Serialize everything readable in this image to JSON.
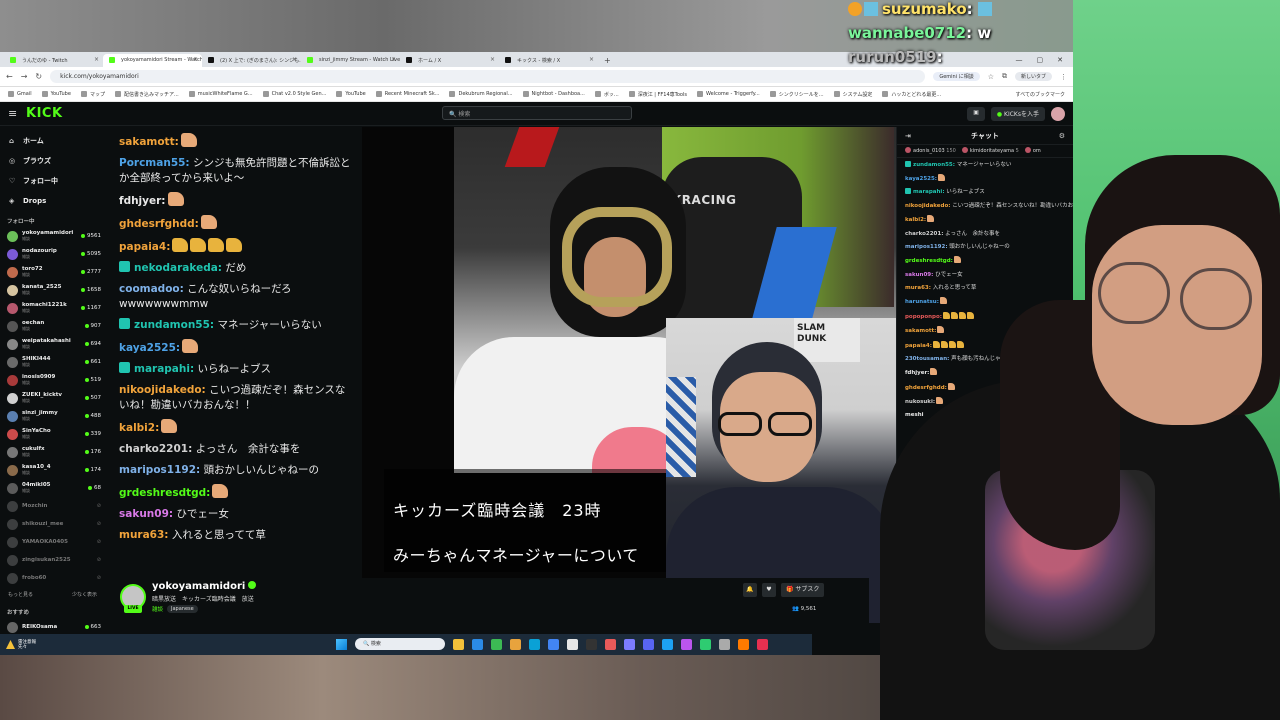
{
  "overlay_chat": [
    {
      "name": "suzumako",
      "text": ""
    },
    {
      "name": "wannabe0712",
      "text": "w"
    },
    {
      "name": "rurun0519",
      "text": ""
    }
  ],
  "browser": {
    "tabs": [
      {
        "label": "うんだのゆ - Twitch",
        "active": false
      },
      {
        "label": "yokoyamamidori Stream - Watch Live on KICK",
        "active": true
      },
      {
        "label": "(2) X 上で: (ぎのまさん): シンジも...",
        "active": false
      },
      {
        "label": "sinzi_jimmy Stream - Watch Live",
        "active": false
      },
      {
        "label": "ホーム / X",
        "active": false
      },
      {
        "label": "キックス - 検索 / X",
        "active": false
      }
    ],
    "new_tab": "+",
    "url": "kick.com/yokoyamamidori",
    "gemini": "Gemini に相談",
    "profile": "新しいタブ",
    "bookmarks": [
      "Gmail",
      "YouTube",
      "マップ",
      "配信書き込みマッチア...",
      "musicWhiteFlame G...",
      "Chat v2.0 Style Gen...",
      "YouTube",
      "Recent Minecraft Sk...",
      "Dekubrum Regional...",
      "Nightbot - Dashboa...",
      "ボッ...",
      "深夜江 | FF14専Tools",
      "Welcome - Triggerfy...",
      "シンクリシールを...",
      "システム設定",
      "ハッカとどれる最更..."
    ],
    "all_bookmarks": "すべてのブックマーク"
  },
  "kick": {
    "logo": "KICK",
    "search_placeholder": "検索",
    "join_label": "KICKsを入手",
    "nav": [
      {
        "label": "ホーム",
        "icon": "home-icon",
        "glyph": "⌂"
      },
      {
        "label": "ブラウズ",
        "icon": "browse-icon",
        "glyph": "◎"
      },
      {
        "label": "フォロー中",
        "icon": "following-icon",
        "glyph": "♡"
      },
      {
        "label": "Drops",
        "icon": "drops-icon",
        "glyph": "◈"
      }
    ],
    "following_label": "フォロー中",
    "following": [
      {
        "name": "yokoyamamidori",
        "sub": "雑談",
        "count": "9561",
        "online": true,
        "color": "#6bbf59"
      },
      {
        "name": "nodazourip",
        "sub": "雑談",
        "count": "5095",
        "online": true,
        "color": "#7b5ad6"
      },
      {
        "name": "toro72",
        "sub": "雑談",
        "count": "2777",
        "online": true,
        "color": "#c06a4c"
      },
      {
        "name": "kanata_2525",
        "sub": "雑談",
        "count": "1658",
        "online": true,
        "color": "#d6c4a0"
      },
      {
        "name": "komachi1221k",
        "sub": "雑談",
        "count": "1167",
        "online": true,
        "color": "#b6586d"
      },
      {
        "name": "oechan",
        "sub": "雑談",
        "count": "907",
        "online": true,
        "color": "#555"
      },
      {
        "name": "weipatakahashi",
        "sub": "雑談",
        "count": "694",
        "online": true,
        "color": "#888"
      },
      {
        "name": "SHIKI444",
        "sub": "雑談",
        "count": "661",
        "online": true,
        "color": "#6a6a6a"
      },
      {
        "name": "inosis0909",
        "sub": "雑談",
        "count": "519",
        "online": true,
        "color": "#a83a3a"
      },
      {
        "name": "ZUEKI_kicktv",
        "sub": "雑談",
        "count": "507",
        "online": true,
        "color": "#d0d0d0"
      },
      {
        "name": "sinzi_jimmy",
        "sub": "雑談",
        "count": "488",
        "online": true,
        "color": "#5a7fb0"
      },
      {
        "name": "SinYaCho",
        "sub": "雑談",
        "count": "339",
        "online": true,
        "color": "#cc4b4b"
      },
      {
        "name": "cukulfx",
        "sub": "雑談",
        "count": "176",
        "online": true,
        "color": "#777"
      },
      {
        "name": "kasa10_4",
        "sub": "雑談",
        "count": "174",
        "online": true,
        "color": "#8a6a4a"
      },
      {
        "name": "04mikl05",
        "sub": "雑談",
        "count": "68",
        "online": true,
        "color": "#5b5b5b"
      },
      {
        "name": "Mozchin",
        "sub": "",
        "count": "",
        "online": false,
        "color": "#888"
      },
      {
        "name": "shikouzi_mee",
        "sub": "",
        "count": "",
        "online": false,
        "color": "#888"
      },
      {
        "name": "YAMAOKA0405",
        "sub": "",
        "count": "",
        "online": false,
        "color": "#888"
      },
      {
        "name": "zingisukan2525",
        "sub": "",
        "count": "",
        "online": false,
        "color": "#888"
      },
      {
        "name": "frobo60",
        "sub": "",
        "count": "",
        "online": false,
        "color": "#888"
      }
    ],
    "show_more": "もっと見る",
    "show_less": "少なく表示",
    "recommended_label": "おすすめ",
    "recommended": [
      {
        "name": "REIKOsama",
        "count": "663"
      }
    ]
  },
  "big_chat": [
    {
      "user": "sakamott:",
      "color": "#f1a33b",
      "text": "",
      "emotes": 1,
      "badge": false
    },
    {
      "user": "Porcman55:",
      "color": "#4ea2e6",
      "text": "シンジも無免許問題と不倫訴訟とか全部終ってから来いよ〜",
      "emotes": 0,
      "badge": false
    },
    {
      "user": "fdhjyer:",
      "color": "#e8e8e8",
      "text": "",
      "emotes": 1,
      "badge": false
    },
    {
      "user": "ghdesrfghdd:",
      "color": "#f1a33b",
      "text": "",
      "emotes": 1,
      "badge": false
    },
    {
      "user": "papaia4:",
      "color": "#f1a33b",
      "text": "",
      "emotes": 4,
      "emote_style": "y",
      "badge": false
    },
    {
      "user": "nekodarakeda:",
      "color": "#20c4b0",
      "text": "だめ",
      "emotes": 0,
      "badge": true
    },
    {
      "user": "coomadoo:",
      "color": "#7fb1e8",
      "text": "こんな奴いらねーだろ wwwwwwwmmw",
      "emotes": 0,
      "badge": false
    },
    {
      "user": "zundamon55:",
      "color": "#20c4b0",
      "text": "マネージャーいらない",
      "emotes": 0,
      "badge": true
    },
    {
      "user": "kaya2525:",
      "color": "#4ea2e6",
      "text": "",
      "emotes": 1,
      "badge": false
    },
    {
      "user": "marapahi:",
      "color": "#20c4b0",
      "text": "いらねーよブス",
      "emotes": 0,
      "badge": true
    },
    {
      "user": "nikoojidakedo:",
      "color": "#f1a33b",
      "text": "こいつ過疎だぞ！森センスないね！勘違いバカおんな！！",
      "emotes": 0,
      "badge": false
    },
    {
      "user": "kalbi2:",
      "color": "#f1a33b",
      "text": "",
      "emotes": 1,
      "badge": false
    },
    {
      "user": "charko2201:",
      "color": "#d0d0d0",
      "text": "よっさん　余計な事を",
      "emotes": 0,
      "badge": false
    },
    {
      "user": "maripos1192:",
      "color": "#7fb1e8",
      "text": "頭おかしいんじゃねーの",
      "emotes": 0,
      "badge": false
    },
    {
      "user": "grdeshresdtgd:",
      "color": "#53fc18",
      "text": "",
      "emotes": 1,
      "badge": false
    },
    {
      "user": "sakun09:",
      "color": "#d979e8",
      "text": "ひでェー女",
      "emotes": 0,
      "badge": false
    },
    {
      "user": "mura63:",
      "color": "#f1a33b",
      "text": "入れると思ってて草",
      "emotes": 0,
      "badge": false
    }
  ],
  "video": {
    "chair_brand": "KRACING",
    "poster_text": "SLAM DUNK",
    "caption_line1": "キッカーズ臨時会議　23時",
    "caption_line2": "みーちゃんマネージャーについて"
  },
  "streamer": {
    "name": "yokoyamamidori",
    "title": "暗黒放送　キッカーズ臨時会議　放送",
    "category": "雑談",
    "tag": "Japanese",
    "live": "LIVE",
    "subscribe": "サブスク",
    "viewers": "9,561"
  },
  "right_chat": {
    "title": "チャット",
    "pins": [
      {
        "name": "adonis_0103",
        "count": "150"
      },
      {
        "name": "kimidoritateyama",
        "count": "5"
      },
      {
        "name": "om",
        "count": ""
      }
    ],
    "messages": [
      {
        "user": "zundamon55:",
        "color": "#20c4b0",
        "text": "マネージャーいらない",
        "emotes": 0,
        "badge": true
      },
      {
        "user": "kaya2525:",
        "color": "#4ea2e6",
        "text": "",
        "emotes": 1,
        "badge": false
      },
      {
        "user": "marapahi:",
        "color": "#20c4b0",
        "text": "いらねーよブス",
        "emotes": 0,
        "badge": true
      },
      {
        "user": "nikoojidakedo:",
        "color": "#f1a33b",
        "text": "こいつ過疎だぞ！森センスないね！勘違いバカおんな！！",
        "emotes": 0,
        "badge": false
      },
      {
        "user": "kalbi2:",
        "color": "#f1a33b",
        "text": "",
        "emotes": 1,
        "badge": false
      },
      {
        "user": "charko2201:",
        "color": "#d0d0d0",
        "text": "よっさん　余計な事を",
        "emotes": 0,
        "badge": false
      },
      {
        "user": "maripos1192:",
        "color": "#7fb1e8",
        "text": "頭おかしいんじゃねーの",
        "emotes": 0,
        "badge": false
      },
      {
        "user": "grdeshresdtgd:",
        "color": "#53fc18",
        "text": "",
        "emotes": 1,
        "badge": false
      },
      {
        "user": "sakun09:",
        "color": "#d979e8",
        "text": "ひでェー女",
        "emotes": 0,
        "badge": false
      },
      {
        "user": "mura63:",
        "color": "#f1a33b",
        "text": "入れると思って草",
        "emotes": 0,
        "badge": false
      },
      {
        "user": "harunatsu:",
        "color": "#4ea2e6",
        "text": "",
        "emotes": 1,
        "badge": false
      },
      {
        "user": "popoponpo:",
        "color": "#e85a5a",
        "text": "",
        "emotes": 4,
        "emote_style": "y",
        "badge": false
      },
      {
        "user": "sakamott:",
        "color": "#f1a33b",
        "text": "",
        "emotes": 1,
        "badge": false
      },
      {
        "user": "papaia4:",
        "color": "#f1a33b",
        "text": "",
        "emotes": 4,
        "emote_style": "y",
        "badge": false
      },
      {
        "user": "230tousaman:",
        "color": "#7fb1e8",
        "text": "声も顔も汚ねんじゃない",
        "emotes": 0,
        "badge": false
      },
      {
        "user": "fdhjyer:",
        "color": "#e8e8e8",
        "text": "",
        "emotes": 1,
        "badge": false
      },
      {
        "user": "ghdesrfghdd:",
        "color": "#f1a33b",
        "text": "",
        "emotes": 1,
        "badge": false
      },
      {
        "user": "nukosuki:",
        "color": "#d0d0d0",
        "text": "",
        "emotes": 1,
        "badge": false
      },
      {
        "user": "meshi",
        "color": "#e8e8e8",
        "text": "",
        "emotes": 0,
        "badge": false
      }
    ]
  },
  "taskbar": {
    "weather_line1": "雷注意報",
    "weather_line2": "先々",
    "search_placeholder": "検索",
    "app_colors": [
      "#f3c13a",
      "#2b8be6",
      "#3cba54",
      "#e8a33d",
      "#0aa1d6",
      "#4285f4",
      "#e6e6e6",
      "#333",
      "#e85a5a",
      "#7c7cff",
      "#5865f2",
      "#1da1f2",
      "#bb55ee",
      "#2ecc71",
      "#aaa",
      "#ff7a00",
      "#e83050"
    ]
  }
}
